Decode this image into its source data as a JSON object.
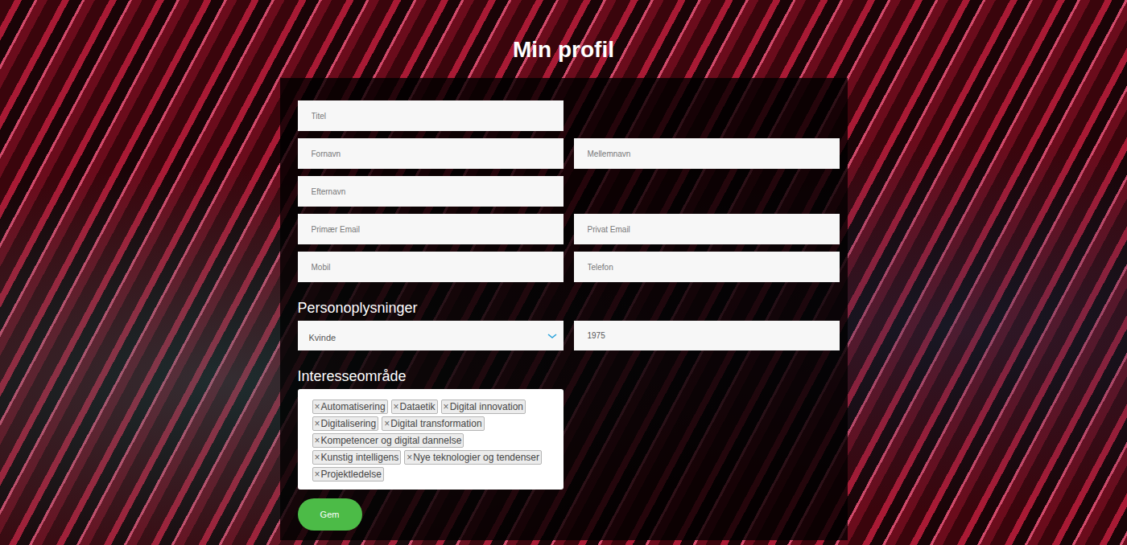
{
  "page": {
    "title": "Min profil"
  },
  "field_rows": [
    {
      "fields": [
        {
          "placeholder": "Titel"
        }
      ]
    },
    {
      "fields": [
        {
          "placeholder": "Fornavn"
        },
        {
          "placeholder": "Mellemnavn"
        }
      ]
    },
    {
      "fields": [
        {
          "placeholder": "Efternavn"
        }
      ]
    },
    {
      "fields": [
        {
          "placeholder": "Primær Email"
        },
        {
          "placeholder": "Privat Email"
        }
      ]
    },
    {
      "fields": [
        {
          "placeholder": "Mobil"
        },
        {
          "placeholder": "Telefon"
        }
      ]
    }
  ],
  "personal": {
    "heading": "Personoplysninger",
    "gender": {
      "value": "Kvinde"
    },
    "birth_year": {
      "value": "1975"
    }
  },
  "interests": {
    "heading": "Interesseområde",
    "tags": [
      {
        "remove": "×",
        "label": "Automatisering"
      },
      {
        "remove": "×",
        "label": "Dataetik"
      },
      {
        "remove": "×",
        "label": "Digital innovation"
      },
      {
        "remove": "×",
        "label": "Digitalisering"
      },
      {
        "remove": "×",
        "label": "Digital transformation"
      },
      {
        "remove": "×",
        "label": "Kompetencer og digital dannelse"
      },
      {
        "remove": "×",
        "label": "Kunstig intelligens"
      },
      {
        "remove": "×",
        "label": "Nye teknologier og tendenser"
      },
      {
        "remove": "×",
        "label": "Projektledelse"
      }
    ]
  },
  "buttons": [
    {
      "label": "Gem"
    }
  ]
}
